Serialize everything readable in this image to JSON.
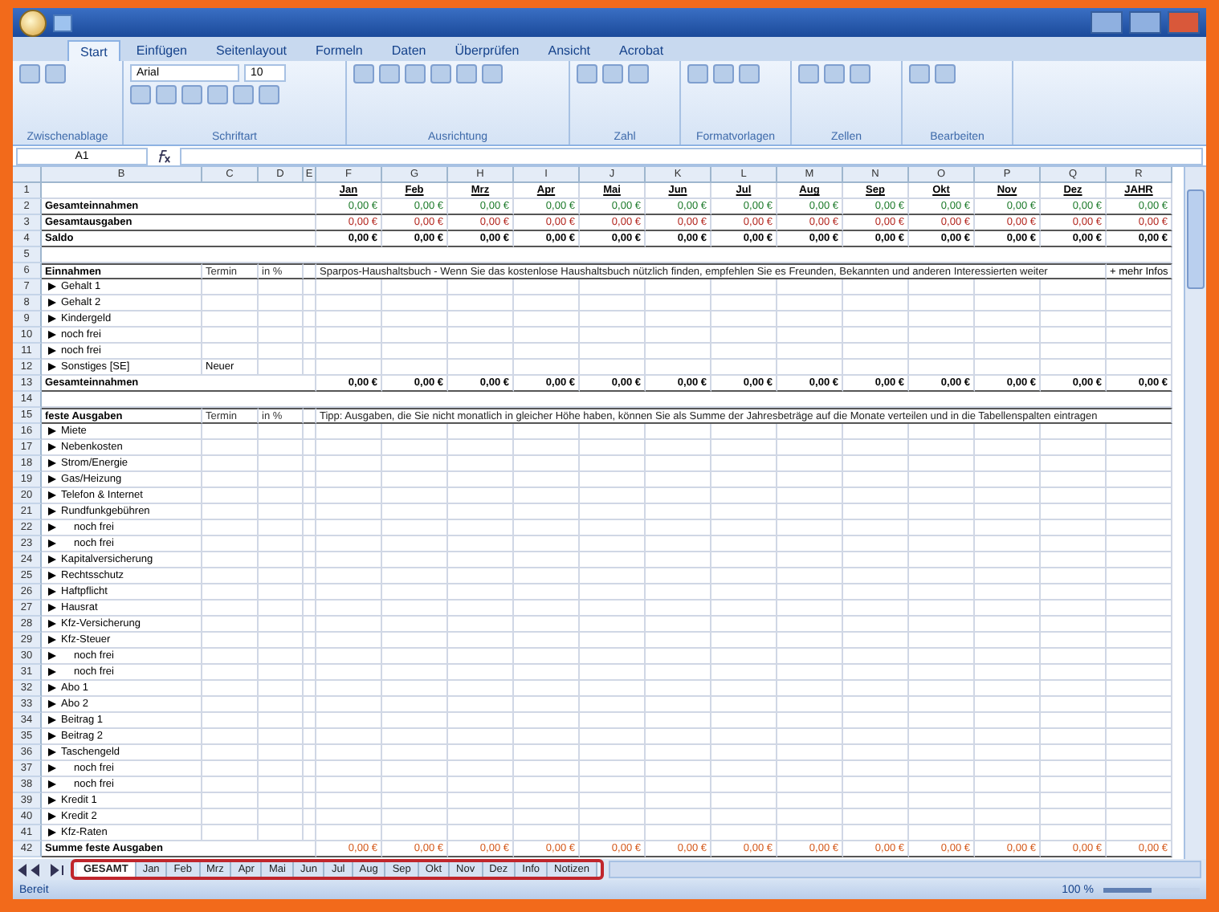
{
  "ribbon": {
    "tabs": [
      {
        "label": "Start",
        "selected": true
      },
      {
        "label": "Einfügen",
        "selected": false
      },
      {
        "label": "Seitenlayout",
        "selected": false
      },
      {
        "label": "Formeln",
        "selected": false
      },
      {
        "label": "Daten",
        "selected": false
      },
      {
        "label": "Überprüfen",
        "selected": false
      },
      {
        "label": "Ansicht",
        "selected": false
      },
      {
        "label": "Acrobat",
        "selected": false
      }
    ],
    "font": {
      "name": "Arial",
      "size": "10"
    },
    "groups": [
      {
        "label": "Zwischenablage"
      },
      {
        "label": "Schriftart"
      },
      {
        "label": "Ausrichtung"
      },
      {
        "label": "Zahl"
      },
      {
        "label": "Formatvorlagen"
      },
      {
        "label": "Zellen"
      },
      {
        "label": "Bearbeiten"
      }
    ]
  },
  "name_box": "A1",
  "columns": [
    "B",
    "C",
    "D",
    "E",
    "F",
    "G",
    "H",
    "I",
    "J",
    "K",
    "L",
    "M",
    "N",
    "O",
    "P",
    "Q",
    "R"
  ],
  "rows": [
    {
      "num": "1",
      "kind": "months",
      "values": [
        "Jan",
        "Feb",
        "Mrz",
        "Apr",
        "Mai",
        "Jun",
        "Jul",
        "Aug",
        "Sep",
        "Okt",
        "Nov",
        "Dez",
        "JAHR"
      ]
    },
    {
      "num": "2",
      "kind": "summary",
      "label": "Gesamteinnahmen",
      "color": "#1d7a2a",
      "values": [
        "0,00 €",
        "0,00 €",
        "0,00 €",
        "0,00 €",
        "0,00 €",
        "0,00 €",
        "0,00 €",
        "0,00 €",
        "0,00 €",
        "0,00 €",
        "0,00 €",
        "0,00 €",
        "0,00 €"
      ]
    },
    {
      "num": "3",
      "kind": "summary",
      "label": "Gesamtausgaben",
      "color": "#b3261e",
      "values": [
        "0,00 €",
        "0,00 €",
        "0,00 €",
        "0,00 €",
        "0,00 €",
        "0,00 €",
        "0,00 €",
        "0,00 €",
        "0,00 €",
        "0,00 €",
        "0,00 €",
        "0,00 €",
        "0,00 €"
      ]
    },
    {
      "num": "4",
      "kind": "summary",
      "label": "Saldo",
      "values": [
        "0,00 €",
        "0,00 €",
        "0,00 €",
        "0,00 €",
        "0,00 €",
        "0,00 €",
        "0,00 €",
        "0,00 €",
        "0,00 €",
        "0,00 €",
        "0,00 €",
        "0,00 €",
        "0,00 €"
      ]
    },
    {
      "num": "5",
      "kind": "blank"
    },
    {
      "num": "6",
      "kind": "section",
      "label": "Einnahmen",
      "termin": "Termin",
      "pct": "in %",
      "note": "Sparpos-Haushaltsbuch - Wenn Sie das kostenlose Haushaltsbuch nützlich finden, empfehlen Sie es Freunden, Bekannten und anderen Interessierten weiter",
      "extra": "+ mehr Infos"
    },
    {
      "num": "7",
      "kind": "item",
      "label": "Gehalt 1"
    },
    {
      "num": "8",
      "kind": "item",
      "label": "Gehalt 2"
    },
    {
      "num": "9",
      "kind": "item",
      "label": "Kindergeld"
    },
    {
      "num": "10",
      "kind": "item",
      "label": "noch frei"
    },
    {
      "num": "11",
      "kind": "item",
      "label": "noch frei"
    },
    {
      "num": "12",
      "kind": "item",
      "label": "Sonstiges [SE]",
      "termin": "Neuer"
    },
    {
      "num": "13",
      "kind": "total",
      "label": "Gesamteinnahmen",
      "values": [
        "0,00 €",
        "0,00 €",
        "0,00 €",
        "0,00 €",
        "0,00 €",
        "0,00 €",
        "0,00 €",
        "0,00 €",
        "0,00 €",
        "0,00 €",
        "0,00 €",
        "0,00 €",
        "0,00 €"
      ]
    },
    {
      "num": "14",
      "kind": "blank"
    },
    {
      "num": "15",
      "kind": "section",
      "label": "feste Ausgaben",
      "termin": "Termin",
      "pct": "in %",
      "note": "Tipp: Ausgaben, die Sie nicht monatlich in gleicher Höhe haben, können Sie als Summe der Jahresbeträge auf die Monate verteilen und in die Tabellenspalten eintragen"
    },
    {
      "num": "16",
      "kind": "item",
      "label": "Miete"
    },
    {
      "num": "17",
      "kind": "item",
      "label": "Nebenkosten"
    },
    {
      "num": "18",
      "kind": "item",
      "label": "Strom/Energie"
    },
    {
      "num": "19",
      "kind": "item",
      "label": "Gas/Heizung"
    },
    {
      "num": "20",
      "kind": "item",
      "label": "Telefon & Internet"
    },
    {
      "num": "21",
      "kind": "item",
      "label": "Rundfunkgebühren"
    },
    {
      "num": "22",
      "kind": "subitem",
      "label": "noch frei"
    },
    {
      "num": "23",
      "kind": "subitem",
      "label": "noch frei"
    },
    {
      "num": "24",
      "kind": "item",
      "label": "Kapitalversicherung"
    },
    {
      "num": "25",
      "kind": "item",
      "label": "Rechtsschutz"
    },
    {
      "num": "26",
      "kind": "item",
      "label": "Haftpflicht"
    },
    {
      "num": "27",
      "kind": "item",
      "label": "Hausrat"
    },
    {
      "num": "28",
      "kind": "item",
      "label": "Kfz-Versicherung"
    },
    {
      "num": "29",
      "kind": "item",
      "label": "Kfz-Steuer"
    },
    {
      "num": "30",
      "kind": "subitem",
      "label": "noch frei"
    },
    {
      "num": "31",
      "kind": "subitem",
      "label": "noch frei"
    },
    {
      "num": "32",
      "kind": "item",
      "label": "Abo 1"
    },
    {
      "num": "33",
      "kind": "item",
      "label": "Abo 2"
    },
    {
      "num": "34",
      "kind": "item",
      "label": "Beitrag 1"
    },
    {
      "num": "35",
      "kind": "item",
      "label": "Beitrag 2"
    },
    {
      "num": "36",
      "kind": "item",
      "label": "Taschengeld"
    },
    {
      "num": "37",
      "kind": "subitem",
      "label": "noch frei"
    },
    {
      "num": "38",
      "kind": "subitem",
      "label": "noch frei"
    },
    {
      "num": "39",
      "kind": "item",
      "label": "Kredit 1"
    },
    {
      "num": "40",
      "kind": "item",
      "label": "Kredit 2"
    },
    {
      "num": "41",
      "kind": "item",
      "label": "Kfz-Raten"
    },
    {
      "num": "42",
      "kind": "total",
      "label": "Summe feste Ausgaben",
      "color": "#d4581a",
      "values": [
        "0,00 €",
        "0,00 €",
        "0,00 €",
        "0,00 €",
        "0,00 €",
        "0,00 €",
        "0,00 €",
        "0,00 €",
        "0,00 €",
        "0,00 €",
        "0,00 €",
        "0,00 €",
        "0,00 €"
      ]
    }
  ],
  "sheet_tabs": [
    {
      "label": "GESAMT",
      "selected": true
    },
    {
      "label": "Jan",
      "selected": false
    },
    {
      "label": "Feb",
      "selected": false
    },
    {
      "label": "Mrz",
      "selected": false
    },
    {
      "label": "Apr",
      "selected": false
    },
    {
      "label": "Mai",
      "selected": false
    },
    {
      "label": "Jun",
      "selected": false
    },
    {
      "label": "Jul",
      "selected": false
    },
    {
      "label": "Aug",
      "selected": false
    },
    {
      "label": "Sep",
      "selected": false
    },
    {
      "label": "Okt",
      "selected": false
    },
    {
      "label": "Nov",
      "selected": false
    },
    {
      "label": "Dez",
      "selected": false
    },
    {
      "label": "Info",
      "selected": false
    },
    {
      "label": "Notizen",
      "selected": false
    }
  ],
  "status_bar": {
    "text": "Bereit",
    "zoom": "100 %",
    "zoom_slider": {
      "level": 0.5
    }
  }
}
